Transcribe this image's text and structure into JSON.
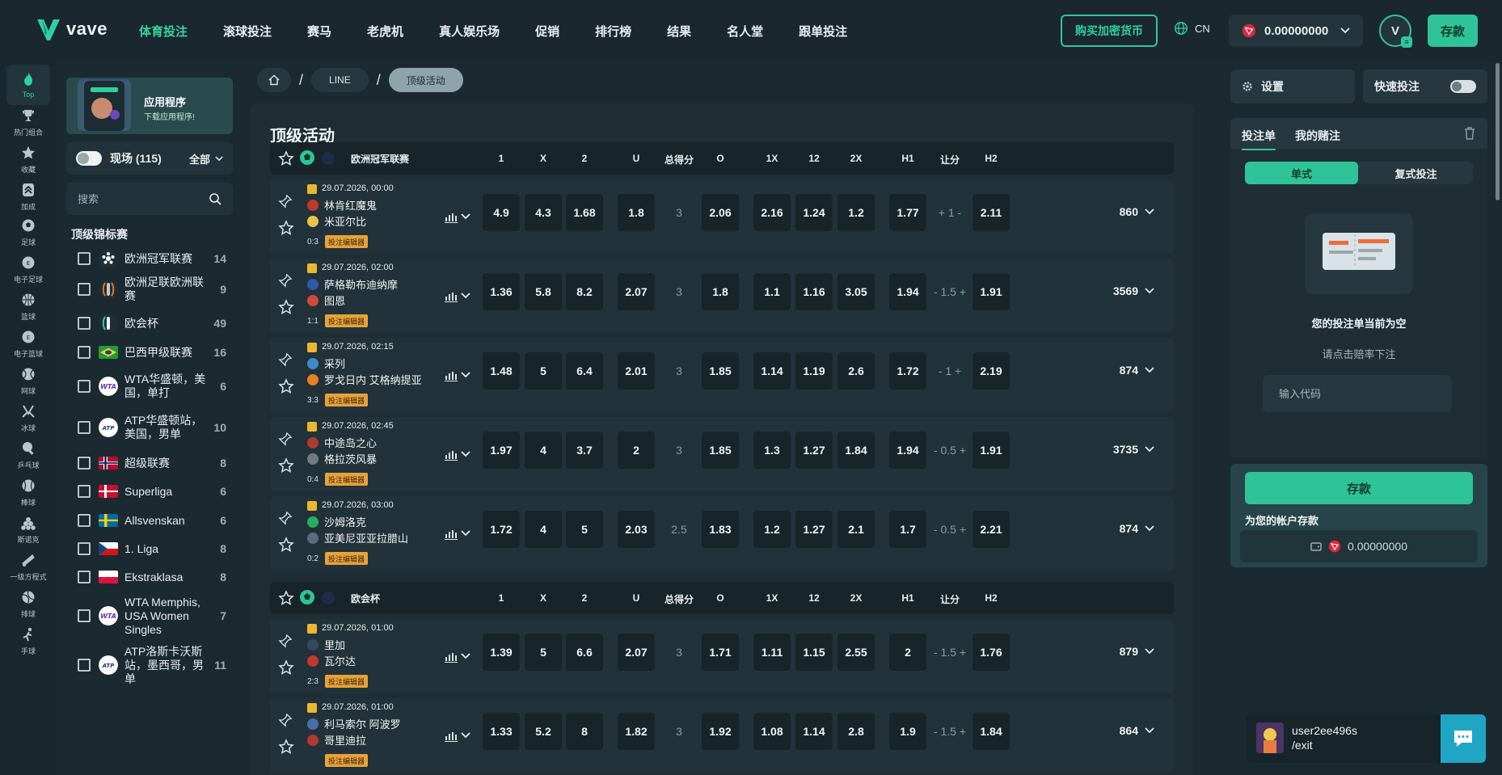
{
  "brand": {
    "name": "vave",
    "accent": "#2ec497"
  },
  "nav": [
    "体育投注",
    "滚球投注",
    "赛马",
    "老虎机",
    "真人娱乐场",
    "促销",
    "排行榜",
    "结果",
    "名人堂",
    "跟单投注"
  ],
  "header": {
    "buy_crypto": "购买加密货币",
    "lang": "CN",
    "balance": "0.00000000",
    "avatar_letter": "V",
    "deposit": "存款"
  },
  "iconbar": [
    {
      "label": "Top",
      "icon": "flame-icon"
    },
    {
      "label": "热门组合",
      "icon": "trophy-icon"
    },
    {
      "label": "收藏",
      "icon": "star-icon"
    },
    {
      "label": "加成",
      "icon": "boost-icon"
    },
    {
      "label": "足球",
      "icon": "soccer-icon"
    },
    {
      "label": "电子足球",
      "icon": "esoccer-icon"
    },
    {
      "label": "篮球",
      "icon": "basketball-icon"
    },
    {
      "label": "电子篮球",
      "icon": "ebasketball-icon"
    },
    {
      "label": "网球",
      "icon": "tennis-icon"
    },
    {
      "label": "冰球",
      "icon": "hockey-icon"
    },
    {
      "label": "乒乓球",
      "icon": "pingpong-icon"
    },
    {
      "label": "棒球",
      "icon": "baseball-icon"
    },
    {
      "label": "斯诺克",
      "icon": "snooker-icon"
    },
    {
      "label": "一级方程式",
      "icon": "f1-icon"
    },
    {
      "label": "排球",
      "icon": "volleyball-icon"
    },
    {
      "label": "手球",
      "icon": "handball-icon"
    }
  ],
  "sidebar": {
    "promo_title": "应用程序",
    "promo_sub": "下载应用程序!",
    "live_label": "现场 (115)",
    "live_filter": "全部",
    "search_placeholder": "搜索",
    "section_title": "顶级锦标赛",
    "leagues": [
      {
        "name": "欧洲冠军联赛",
        "count": "14",
        "flag": "ucl"
      },
      {
        "name": "欧洲足联欧洲联赛",
        "count": "9",
        "flag": "uel"
      },
      {
        "name": "欧会杯",
        "count": "49",
        "flag": "uecl"
      },
      {
        "name": "巴西甲级联赛",
        "count": "16",
        "flag": "br"
      },
      {
        "name": "WTA华盛顿，美国，单打",
        "count": "6",
        "flag": "wta"
      },
      {
        "name": "ATP华盛顿站，美国，男单",
        "count": "10",
        "flag": "atp"
      },
      {
        "name": "超级联赛",
        "count": "8",
        "flag": "no"
      },
      {
        "name": "Superliga",
        "count": "6",
        "flag": "dk"
      },
      {
        "name": "Allsvenskan",
        "count": "6",
        "flag": "se"
      },
      {
        "name": "1. Liga",
        "count": "8",
        "flag": "cz"
      },
      {
        "name": "Ekstraklasa",
        "count": "8",
        "flag": "pl"
      },
      {
        "name": "WTA Memphis, USA Women Singles",
        "count": "7",
        "flag": "wta"
      },
      {
        "name": "ATP洛斯卡沃斯站，墨西哥，男单",
        "count": "11",
        "flag": "atp"
      }
    ]
  },
  "breadcrumb": {
    "line": "LINE",
    "current": "顶级活动"
  },
  "page_title": "顶级活动",
  "columns": [
    "1",
    "X",
    "2",
    "U",
    "总得分",
    "O",
    "1X",
    "12",
    "2X",
    "H1",
    "让分",
    "H2"
  ],
  "groups": [
    {
      "name": "欧洲冠军联赛",
      "matches": [
        {
          "date": "29.07.2026, 00:00",
          "home": "林肯红魔鬼",
          "away": "米亚尔比",
          "score": "0:3",
          "badge": "投注编辑器",
          "odds": [
            "4.9",
            "4.3",
            "1.68",
            "1.8",
            "3",
            "2.06",
            "2.16",
            "1.24",
            "1.2",
            "1.77",
            "+ 1 -",
            "2.11"
          ],
          "more": "860"
        },
        {
          "date": "29.07.2026, 02:00",
          "home": "萨格勒布迪纳摩",
          "away": "图恩",
          "score": "1:1",
          "badge": "投注编辑器",
          "odds": [
            "1.36",
            "5.8",
            "8.2",
            "2.07",
            "3",
            "1.8",
            "1.1",
            "1.16",
            "3.05",
            "1.94",
            "- 1.5 +",
            "1.91"
          ],
          "more": "3569"
        },
        {
          "date": "29.07.2026, 02:15",
          "home": "采列",
          "away": "罗戈日内 艾格纳提亚",
          "score": "3:3",
          "badge": "投注编辑器",
          "odds": [
            "1.48",
            "5",
            "6.4",
            "2.01",
            "3",
            "1.85",
            "1.14",
            "1.19",
            "2.6",
            "1.72",
            "- 1 +",
            "2.19"
          ],
          "more": "874"
        },
        {
          "date": "29.07.2026, 02:45",
          "home": "中途岛之心",
          "away": "格拉茨风暴",
          "score": "0:4",
          "badge": "投注编辑器",
          "odds": [
            "1.97",
            "4",
            "3.7",
            "2",
            "3",
            "1.85",
            "1.3",
            "1.27",
            "1.84",
            "1.94",
            "- 0.5 +",
            "1.91"
          ],
          "more": "3735"
        },
        {
          "date": "29.07.2026, 03:00",
          "home": "沙姆洛克",
          "away": "亚美尼亚亚拉腊山",
          "score": "0:2",
          "badge": "投注编辑器",
          "odds": [
            "1.72",
            "4",
            "5",
            "2.03",
            "2.5",
            "1.83",
            "1.2",
            "1.27",
            "2.1",
            "1.7",
            "- 0.5 +",
            "2.21"
          ],
          "more": "874"
        }
      ]
    },
    {
      "name": "欧会杯",
      "matches": [
        {
          "date": "29.07.2026, 01:00",
          "home": "里加",
          "away": "瓦尔达",
          "score": "2:3",
          "badge": "投注编辑器",
          "odds": [
            "1.39",
            "5",
            "6.6",
            "2.07",
            "3",
            "1.71",
            "1.11",
            "1.15",
            "2.55",
            "2",
            "- 1.5 +",
            "1.76"
          ],
          "more": "879"
        },
        {
          "date": "29.07.2026, 01:00",
          "home": "利马索尔 阿波罗",
          "away": "哥里迪拉",
          "score": "",
          "badge": "投注编辑器",
          "odds": [
            "1.33",
            "5.2",
            "8",
            "1.82",
            "3",
            "1.92",
            "1.08",
            "1.14",
            "2.8",
            "1.9",
            "- 1.5 +",
            "1.84"
          ],
          "more": "864"
        }
      ]
    }
  ],
  "betslip": {
    "settings": "设置",
    "quickbet": "快速投注",
    "tab_slip": "投注单",
    "tab_mybets": "我的赌注",
    "single": "单式",
    "multi": "复式投注",
    "empty_title": "您的投注单当前为空",
    "empty_sub": "请点击赔率下注",
    "code_placeholder": "输入代码",
    "deposit_btn": "存款",
    "deposit_label": "为您的帐户存款",
    "deposit_amount": "0.00000000"
  },
  "user": {
    "name": "user2ee496s",
    "exit": "/exit"
  }
}
